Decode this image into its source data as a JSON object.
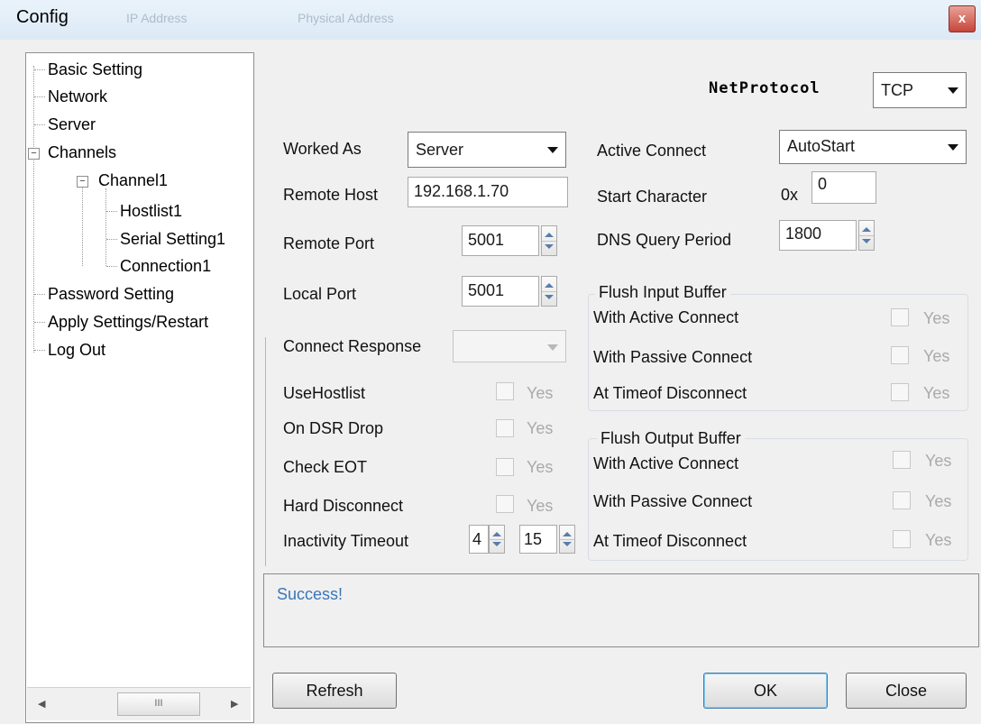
{
  "window": {
    "title": "Config",
    "close_glyph": "x",
    "ghost_header_1": "IP Address",
    "ghost_header_2": "Physical Address"
  },
  "tree": {
    "items": [
      {
        "label": "Basic Setting"
      },
      {
        "label": "Network"
      },
      {
        "label": "Server"
      },
      {
        "label": "Channels",
        "expander": "−"
      },
      {
        "label": "Channel1",
        "expander": "−"
      },
      {
        "label": "Hostlist1"
      },
      {
        "label": "Serial Setting1"
      },
      {
        "label": "Connection1"
      },
      {
        "label": "Password Setting"
      },
      {
        "label": "Apply Settings/Restart"
      },
      {
        "label": "Log Out"
      }
    ],
    "scroll_left": "◀",
    "scroll_right": "▶",
    "scroll_grip": "III"
  },
  "protocol": {
    "label": "NetProtocol",
    "value": "TCP"
  },
  "left_form": {
    "worked_as": {
      "label": "Worked As",
      "value": "Server"
    },
    "remote_host": {
      "label": "Remote Host",
      "value": "192.168.1.70"
    },
    "remote_port": {
      "label": "Remote Port",
      "value": "5001"
    },
    "local_port": {
      "label": "Local Port",
      "value": "5001"
    },
    "connect_response": {
      "label": "Connect Response",
      "value": ""
    },
    "use_hostlist": {
      "label": "UseHostlist",
      "yes": "Yes"
    },
    "on_dsr_drop": {
      "label": "On DSR Drop",
      "yes": "Yes"
    },
    "check_eot": {
      "label": "Check EOT",
      "yes": "Yes"
    },
    "hard_disconnect": {
      "label": "Hard Disconnect",
      "yes": "Yes"
    },
    "inactivity_timeout": {
      "label": "Inactivity Timeout",
      "value_1": "4",
      "value_2": "15"
    }
  },
  "right_form": {
    "active_connect": {
      "label": "Active Connect",
      "value": "AutoStart"
    },
    "start_character": {
      "label": "Start Character",
      "prefix": "0x",
      "value": "0"
    },
    "dns_query_period": {
      "label": "DNS Query Period",
      "value": "1800"
    }
  },
  "flush_input": {
    "title": "Flush Input Buffer",
    "rows": [
      {
        "label": "With Active Connect",
        "yes": "Yes"
      },
      {
        "label": "With Passive Connect",
        "yes": "Yes"
      },
      {
        "label": "At Timeof Disconnect",
        "yes": "Yes"
      }
    ]
  },
  "flush_output": {
    "title": "Flush Output Buffer",
    "rows": [
      {
        "label": "With Active Connect",
        "yes": "Yes"
      },
      {
        "label": "With Passive Connect",
        "yes": "Yes"
      },
      {
        "label": "At Timeof Disconnect",
        "yes": "Yes"
      }
    ]
  },
  "status": {
    "message": "Success!"
  },
  "buttons": {
    "refresh": "Refresh",
    "ok": "OK",
    "close": "Close"
  }
}
